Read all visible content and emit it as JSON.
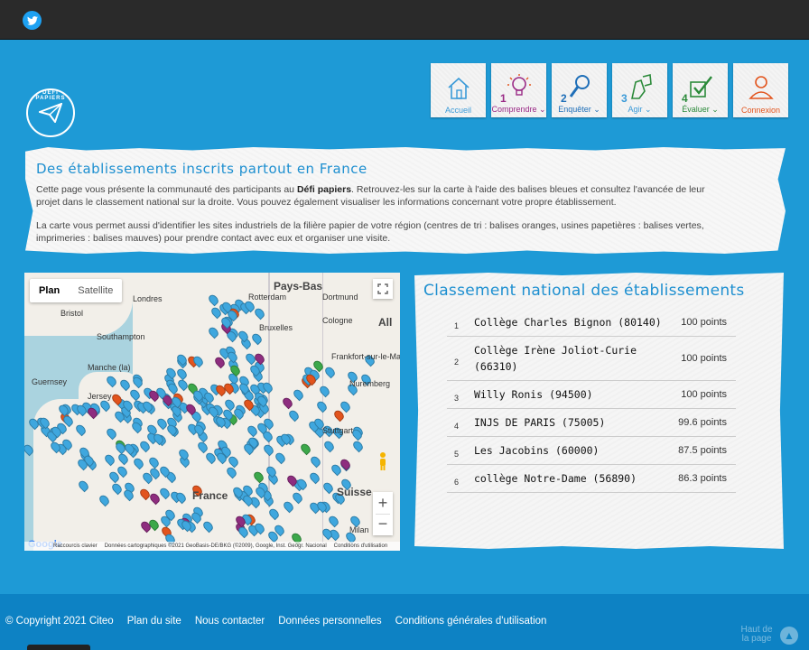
{
  "header": {
    "twitter_icon": "twitter-icon"
  },
  "logo": {
    "text": "DÉFI PAPIERS",
    "icon": "paper-plane-icon"
  },
  "nav": [
    {
      "label": "Accueil",
      "num": "",
      "color": "#3a9ad8",
      "icon": "house-icon"
    },
    {
      "label": "Comprendre",
      "num": "1",
      "color": "#9a2a86",
      "icon": "bulb-icon",
      "chevron": true
    },
    {
      "label": "Enquêter",
      "num": "2",
      "color": "#1f6fb8",
      "icon": "magnifier-icon",
      "chevron": true
    },
    {
      "label": "Agir",
      "num": "3",
      "color": "#3a9ad8",
      "icon": "hands-icon",
      "chevron": true
    },
    {
      "label": "Évaluer",
      "num": "4",
      "color": "#2b8a3a",
      "icon": "check-icon",
      "chevron": true
    },
    {
      "label": "Connexion",
      "num": "",
      "color": "#e2541d",
      "icon": "user-icon"
    }
  ],
  "intro": {
    "title": "Des établissements inscrits partout en France",
    "p1_a": "Cette page vous présente la communauté des participants au ",
    "p1_b": "Défi papiers",
    "p1_c": ". Retrouvez-les sur la carte à l'aide des balises bleues et consultez l'avancée de leur projet dans le classement national sur la droite. Vous pouvez également visualiser les informations concernant votre propre établissement.",
    "p2": "La carte vous permet aussi d'identifier les sites industriels de la filière papier de votre région (centres de tri : balises oranges, usines papetières : balises vertes, imprimeries : balises mauves) pour prendre contact avec eux et organiser une visite."
  },
  "map": {
    "tab_plan": "Plan",
    "tab_satellite": "Satellite",
    "zoom_in": "+",
    "zoom_out": "−",
    "fullscreen_icon": "fullscreen-icon",
    "pegman_icon": "pegman-icon",
    "labels": [
      {
        "text": "Pays-Bas",
        "cls": "big"
      },
      {
        "text": "Londres"
      },
      {
        "text": "Rotterdam"
      },
      {
        "text": "Dortmund"
      },
      {
        "text": "Bristol"
      },
      {
        "text": "Cologne"
      },
      {
        "text": "All",
        "cls": "big"
      },
      {
        "text": "Southampton"
      },
      {
        "text": "Bruxelles"
      },
      {
        "text": "Frankfort-sur-le-Main"
      },
      {
        "text": "Manche (la)"
      },
      {
        "text": "Nuremberg"
      },
      {
        "text": "Guernsey"
      },
      {
        "text": "Jersey"
      },
      {
        "text": "Stuttgart"
      },
      {
        "text": "France",
        "cls": "big"
      },
      {
        "text": "Suisse",
        "cls": "big"
      },
      {
        "text": "Milan"
      }
    ],
    "google": "Google",
    "footer_items": [
      "Raccourcis clavier",
      "Données cartographiques ©2021 GeoBasis-DE/BKG (©2009), Google, Inst. Geogr. Nacional",
      "Conditions d'utilisation"
    ]
  },
  "ranking": {
    "title": "Classement national des établissements",
    "rows": [
      {
        "pos": "1",
        "name": "Collège Charles Bignon (80140)",
        "points": "100 points"
      },
      {
        "pos": "2",
        "name": "Collège Irène Joliot-Curie (66310)",
        "points": "100 points"
      },
      {
        "pos": "3",
        "name": "Willy Ronis (94500)",
        "points": "100 points"
      },
      {
        "pos": "4",
        "name": "INJS DE PARIS (75005)",
        "points": "99.6 points"
      },
      {
        "pos": "5",
        "name": "Les Jacobins (60000)",
        "points": "87.5 points"
      },
      {
        "pos": "6",
        "name": "collège Notre-Dame (56890)",
        "points": "86.3 points"
      }
    ]
  },
  "footer": {
    "links": [
      "© Copyright 2021 Citeo",
      "Plan du site",
      "Nous contacter",
      "Données personnelles",
      "Conditions générales d'utilisation"
    ],
    "back_top": "Haut de la page"
  }
}
